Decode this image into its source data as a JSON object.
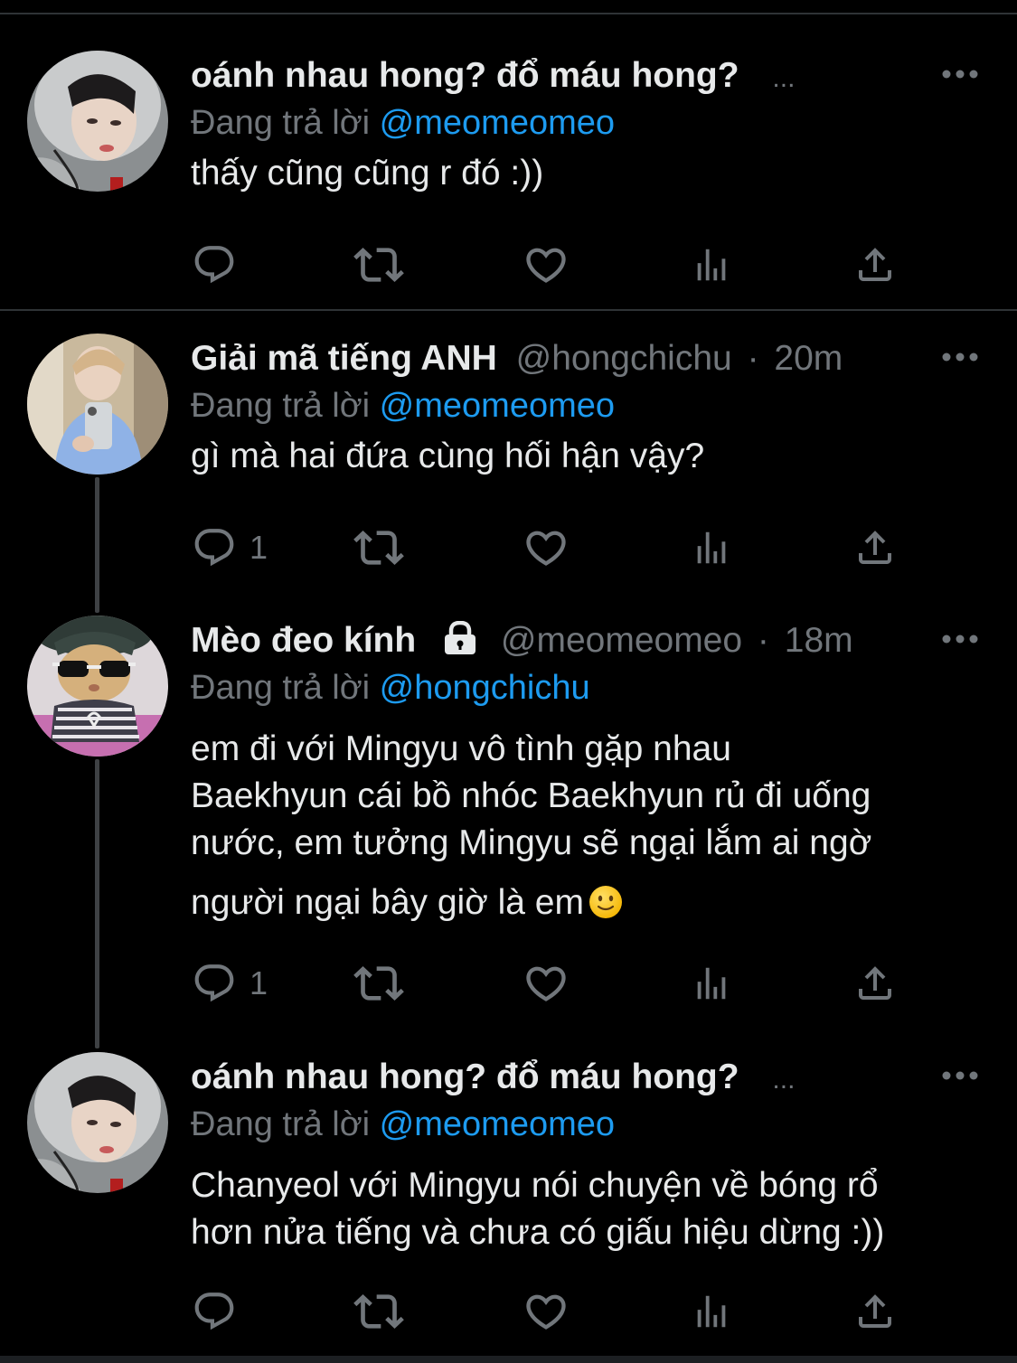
{
  "colors": {
    "background": "#000000",
    "text": "#e7e9ea",
    "muted": "#71767b",
    "mention": "#1d9bf0",
    "divider": "#2f3336"
  },
  "tweets": [
    {
      "display_name": "oánh nhau hong? đổ máu hong?",
      "handle": "",
      "time": "",
      "truncated_marker": "...",
      "avatar_icon": "avatar-person-hood",
      "replying_prefix": "Đang trả lời",
      "replying_mention": "@meomeomeo",
      "lines": [
        "thấy cũng cũng r đó :))"
      ],
      "reply_count": "",
      "more_label": "•••"
    },
    {
      "display_name": "Giải mã tiếng ANH",
      "handle": "@hongchichu",
      "separator": "·",
      "time": "20m",
      "avatar_icon": "avatar-person-mirror-selfie",
      "replying_prefix": "Đang trả lời",
      "replying_mention": "@meomeomeo",
      "lines": [
        "gì mà hai đứa cùng hối hận vậy?"
      ],
      "reply_count": "1",
      "more_label": "•••"
    },
    {
      "display_name": "Mèo đeo kính",
      "handle": "@meomeomeo",
      "separator": "·",
      "time": "18m",
      "protected_icon": "lock-icon",
      "avatar_icon": "avatar-cat-sunglasses",
      "replying_prefix": "Đang trả lời",
      "replying_mention": "@hongchichu",
      "lines": [
        "em đi với Mingyu vô tình gặp nhau",
        "Baekhyun cái bồ nhóc Baekhyun rủ đi uống",
        "nước, em tưởng Mingyu sẽ ngại lắm ai ngờ",
        "người ngại bây giờ là em"
      ],
      "emoji": "slightly-smiling-face-icon",
      "reply_count": "1",
      "more_label": "•••"
    },
    {
      "display_name": "oánh nhau hong? đổ máu hong?",
      "handle": "",
      "time": "",
      "truncated_marker": "...",
      "avatar_icon": "avatar-person-hood",
      "replying_prefix": "Đang trả lời",
      "replying_mention": "@meomeomeo",
      "lines": [
        "Chanyeol với Mingyu nói chuyện về bóng rổ",
        "hơn nửa tiếng và chưa có giấu hiệu dừng :))"
      ],
      "reply_count": "",
      "more_label": "•••"
    }
  ]
}
